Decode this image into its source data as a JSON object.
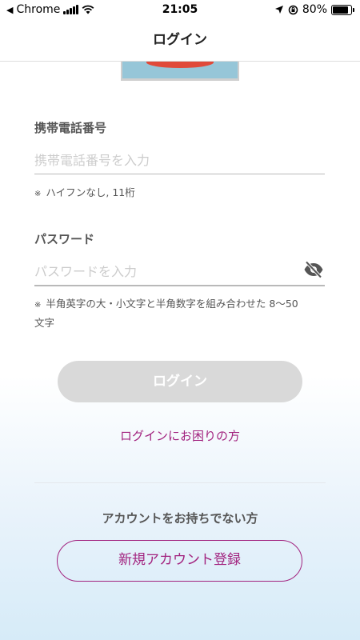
{
  "status_bar": {
    "back_app": "Chrome",
    "time": "21:05",
    "battery": "80%"
  },
  "header": {
    "title": "ログイン"
  },
  "form": {
    "phone": {
      "label": "携帯電話番号",
      "placeholder": "携帯電話番号を入力",
      "value": "",
      "note_mark": "※",
      "note": "ハイフンなし, 11桁"
    },
    "password": {
      "label": "パスワード",
      "placeholder": "パスワードを入力",
      "value": "",
      "note_mark": "※",
      "note_line1": "半角英字の大・小文字と半角数字を組み合わせた 8〜50",
      "note_line2": "文字"
    },
    "login_button": "ログイン",
    "trouble_link": "ログインにお困りの方"
  },
  "account": {
    "prompt": "アカウントをお持ちでない方",
    "register_button": "新規アカウント登録"
  },
  "colors": {
    "accent": "#a2237f",
    "disabled_button": "#d9d9d9",
    "label": "#555555",
    "placeholder": "#cccccc"
  },
  "icons": {
    "password_toggle": "eye-slash-icon",
    "back": "back-arrow-icon",
    "signal": "signal-icon",
    "wifi": "wifi-icon",
    "location": "location-arrow-icon",
    "rotation_lock": "rotation-lock-icon",
    "battery": "battery-icon"
  }
}
